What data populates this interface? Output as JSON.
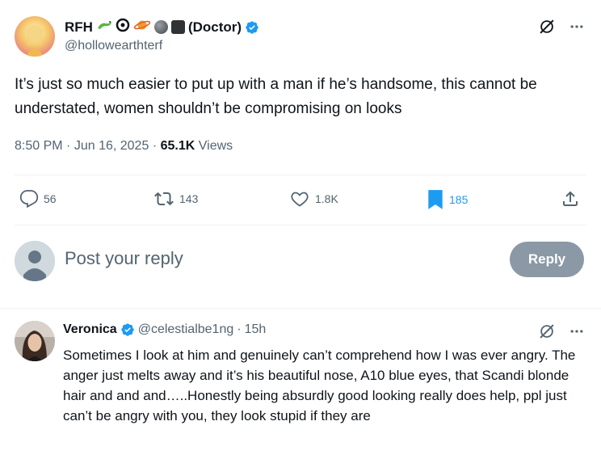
{
  "post": {
    "author": {
      "name": "RFH",
      "role": "(Doctor)",
      "handle": "@hollowearthterf",
      "emojis": [
        "lizard",
        "magnifier",
        "planet",
        "moon",
        "black-square"
      ]
    },
    "text": "It’s just so much easier to put up with a man if he’s handsome, this cannot be understated, women shouldn’t be compromising on looks",
    "time": "8:50 PM",
    "date": "Jun 16, 2025",
    "views_count": "65.1K",
    "views_label": "Views",
    "stats": {
      "replies": "56",
      "reposts": "143",
      "likes": "1.8K",
      "bookmarks": "185"
    }
  },
  "reply_box": {
    "placeholder": "Post your reply",
    "button": "Reply"
  },
  "comment": {
    "name": "Veronica",
    "handle": "@celestialbe1ng",
    "time": "15h",
    "text": "Sometimes I look at him and genuinely can’t comprehend how I was ever angry. The anger just melts away and it’s his beautiful nose, A10 blue eyes, that Scandi blonde hair and and and…..Honestly being absurdly good looking really does help, ppl just can’t be angry with you, they look stupid if they are"
  },
  "colors": {
    "text": "#0f1419",
    "muted": "#536471",
    "accent": "#1d9bf0",
    "reply_button": "#8b98a5",
    "divider": "#eff3f4"
  },
  "icons": [
    "grok-icon",
    "more-icon",
    "verified-icon",
    "reply-icon",
    "repost-icon",
    "like-icon",
    "bookmark-icon",
    "share-icon"
  ]
}
